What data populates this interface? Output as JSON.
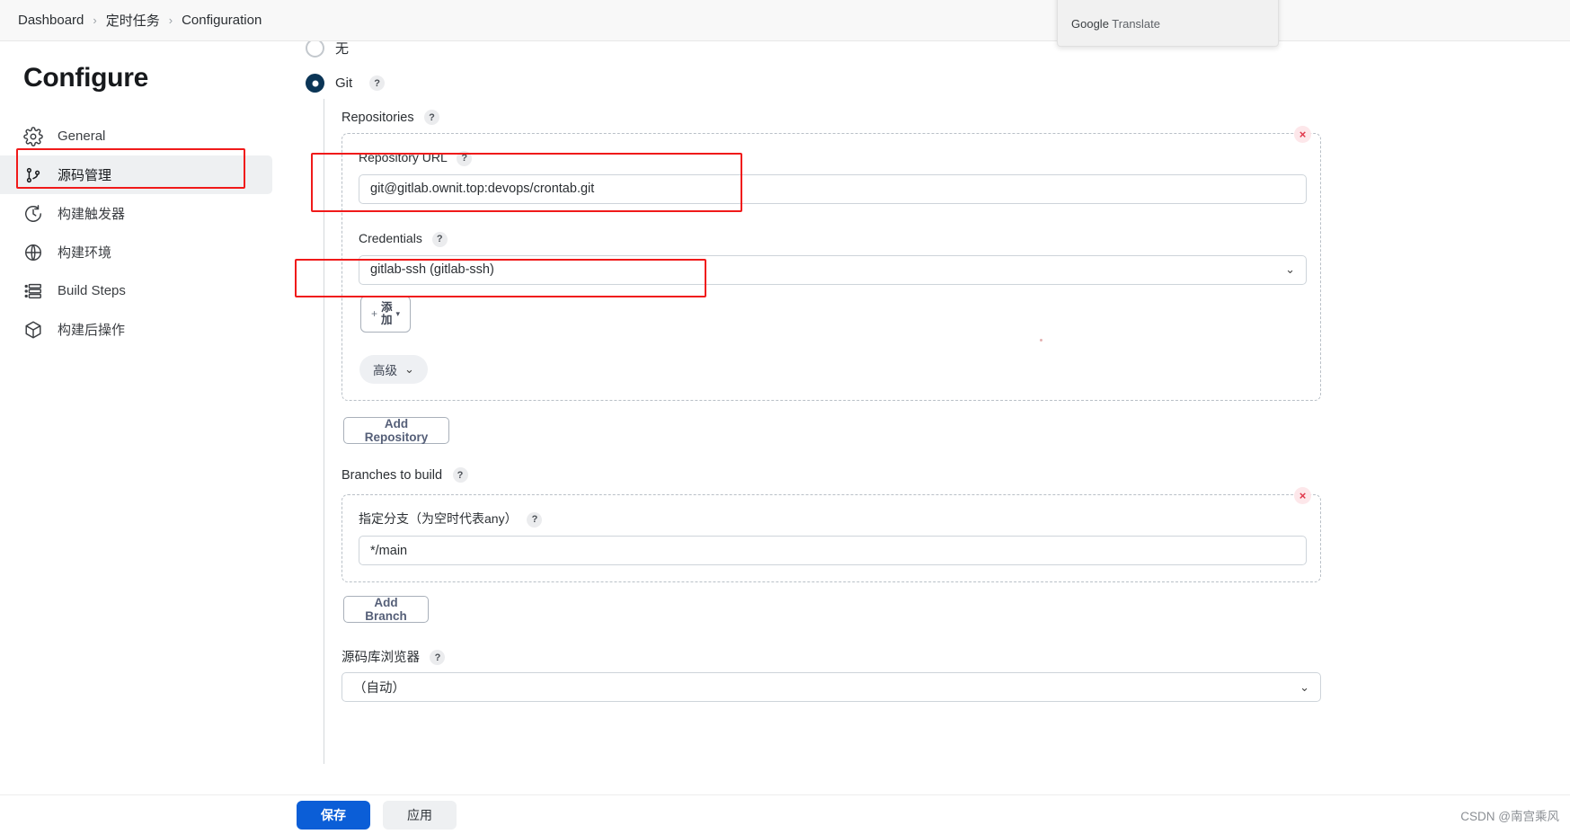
{
  "breadcrumb": {
    "items": [
      "Dashboard",
      "定时任务",
      "Configuration"
    ],
    "separator": "›"
  },
  "sidebar": {
    "title": "Configure",
    "items": [
      {
        "label": "General",
        "icon": "gear-icon",
        "active": false
      },
      {
        "label": "源码管理",
        "icon": "source-control-icon",
        "active": true
      },
      {
        "label": "构建触发器",
        "icon": "clock-icon",
        "active": false
      },
      {
        "label": "构建环境",
        "icon": "globe-icon",
        "active": false
      },
      {
        "label": "Build Steps",
        "icon": "list-steps-icon",
        "active": false
      },
      {
        "label": "构建后操作",
        "icon": "package-icon",
        "active": false
      }
    ]
  },
  "scm": {
    "option_none": {
      "label": "无",
      "selected": false
    },
    "option_git": {
      "label": "Git",
      "selected": true,
      "help": "?"
    },
    "repositories_label": "Repositories",
    "repository_url_label": "Repository URL",
    "repository_url_value": "git@gitlab.ownit.top:devops/crontab.git",
    "credentials_label": "Credentials",
    "credentials_value": "gitlab-ssh (gitlab-ssh)",
    "add_credential_button": {
      "plus": "+",
      "line1": "添",
      "line2": "加",
      "caret": "▾"
    },
    "advanced_button": {
      "label": "高级",
      "caret": "⌄"
    },
    "add_repository_button": "Add Repository",
    "branches_label": "Branches to build",
    "branch_specifier_label": "指定分支（为空时代表any）",
    "branch_specifier_value": "*/main",
    "add_branch_button": "Add Branch",
    "repo_browser_label": "源码库浏览器",
    "repo_browser_value": "（自动）",
    "help_glyph": "?",
    "remove_glyph": "×",
    "chevron_glyph": "⌄"
  },
  "footer": {
    "save_label": "保存",
    "apply_label": "应用",
    "watermark": "CSDN @南宫乘风"
  },
  "google_translate": {
    "label_brand": "Google",
    "label_rest": " Translate"
  },
  "colors": {
    "accent_blue": "#0b5ed7",
    "radio_selected": "#0b3556",
    "highlight_red": "#f01a1a",
    "remove_red": "#e0364a",
    "sidebar_active_bg": "#eef0f2"
  }
}
